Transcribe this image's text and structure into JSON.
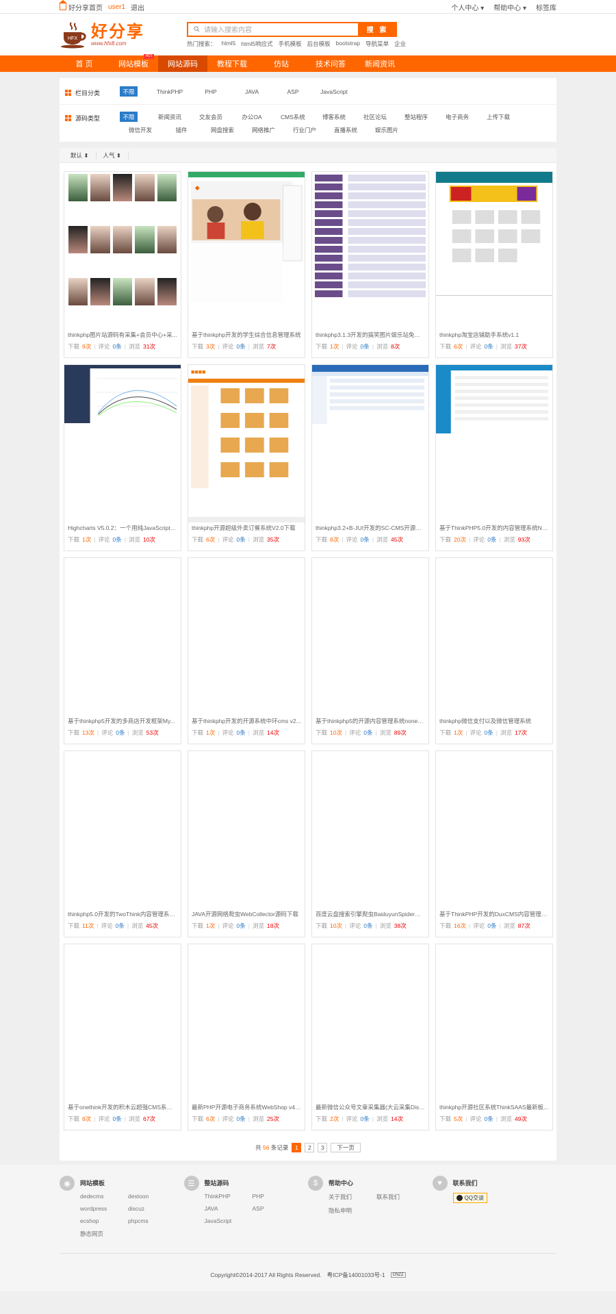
{
  "topbar": {
    "home_link": "好分享首页",
    "user": "user1",
    "logout": "退出",
    "right": [
      "个人中心",
      "帮助中心",
      "标签库"
    ]
  },
  "logo": {
    "title": "好分享",
    "url": "www.hfx8.com"
  },
  "search": {
    "placeholder": "请输入搜索内容",
    "button": "搜 索",
    "hot_label": "热门搜索：",
    "hot": [
      "html5",
      "html5响应式",
      "手机模板",
      "后台模板",
      "bootstrap",
      "导航菜单",
      "企业"
    ]
  },
  "nav": {
    "items": [
      "首 页",
      "网站模板",
      "网站源码",
      "教程下载",
      "仿站",
      "技术问答",
      "新闻资讯"
    ],
    "active": 2,
    "hot_badge": "HOT"
  },
  "filter": {
    "category_label": "栏目分类",
    "categories": [
      "不限",
      "ThinkPHP",
      "PHP",
      "JAVA",
      "ASP",
      "JavaScript"
    ],
    "type_label": "源码类型",
    "types": [
      "不限",
      "新闻资讯",
      "交友会员",
      "办公OA",
      "CMS系统",
      "博客系统",
      "社区论坛",
      "整站程序",
      "电子商务",
      "上传下载",
      "微信开发",
      "插件",
      "网盘搜索",
      "网络推广",
      "行业门户",
      "直播系统",
      "娱乐图片"
    ]
  },
  "sort": [
    "默认",
    "人气"
  ],
  "stats_labels": {
    "down": "下载",
    "comment": "评论",
    "view": "浏览",
    "unit": "次",
    "unit_c": "条"
  },
  "cards": [
    {
      "title": "thinkphp图片站源码有采集+会员中心+采...",
      "down": "9",
      "comment": "0",
      "view": "31",
      "thumb": "photos"
    },
    {
      "title": "基于thinkphp开发的学生综合信息管理系统",
      "down": "3",
      "comment": "0",
      "view": "7",
      "thumb": "mgmt"
    },
    {
      "title": "thinkphp3.1.3开发的搞笑图片娱乐站免费...",
      "down": "1",
      "comment": "0",
      "view": "8",
      "thumb": "list"
    },
    {
      "title": "thinkphp淘宝店铺助手系统v1.1",
      "down": "6",
      "comment": "0",
      "view": "37",
      "thumb": "shop"
    },
    {
      "title": "Highcharts V5.0.2：一个用纯JavaScript编...",
      "down": "1",
      "comment": "0",
      "view": "10",
      "thumb": "chart"
    },
    {
      "title": "thinkphp开源超级外卖订餐系统V2.0下载",
      "down": "6",
      "comment": "0",
      "view": "35",
      "thumb": "food"
    },
    {
      "title": "thinkphp3.2+B-JUI开发的SC-CMS开源内...",
      "down": "8",
      "comment": "0",
      "view": "45",
      "thumb": "admin"
    },
    {
      "title": "基于ThinkPHP5.0开发的内容管理系统New...",
      "down": "20",
      "comment": "0",
      "view": "93",
      "thumb": "admin2"
    },
    {
      "title": "基于thinkphp5开发的多商店开发框架My...",
      "down": "13",
      "comment": "0",
      "view": "53",
      "thumb": ""
    },
    {
      "title": "基于thinkphp开发的开源系统中环cms v2...",
      "down": "1",
      "comment": "0",
      "view": "14",
      "thumb": ""
    },
    {
      "title": "基于thinkphp5的开源内容管理系统noneC...",
      "down": "10",
      "comment": "0",
      "view": "89",
      "thumb": ""
    },
    {
      "title": "thinkphp微信支付以及微信管理系统",
      "down": "1",
      "comment": "0",
      "view": "17",
      "thumb": ""
    },
    {
      "title": "thinkphp5.0开发的TwoThink内容管理系统...",
      "down": "11",
      "comment": "0",
      "view": "45",
      "thumb": ""
    },
    {
      "title": "JAVA开源网络爬虫WebCollector源码下载",
      "down": "1",
      "comment": "0",
      "view": "18",
      "thumb": ""
    },
    {
      "title": "百度云盘搜索引擎爬虫BaiduyunSpider基...",
      "down": "10",
      "comment": "0",
      "view": "38",
      "thumb": ""
    },
    {
      "title": "基于ThinkPHP开发的DuxCMS内容管理系...",
      "down": "16",
      "comment": "0",
      "view": "87",
      "thumb": ""
    },
    {
      "title": "基于onethink开发的积木云超强CMS系统V...",
      "down": "8",
      "comment": "0",
      "view": "67",
      "thumb": ""
    },
    {
      "title": "最新PHP开源电子商务系统WebShop v4.7...",
      "down": "6",
      "comment": "0",
      "view": "25",
      "thumb": ""
    },
    {
      "title": "最新微信公众号文章采集器(大云采集Disc...",
      "down": "2",
      "comment": "0",
      "view": "14",
      "thumb": ""
    },
    {
      "title": "thinkphp开源社区系统ThinkSAAS最新板...",
      "down": "5",
      "comment": "0",
      "view": "49",
      "thumb": ""
    }
  ],
  "pager": {
    "total_prefix": "共",
    "total": "56",
    "total_suffix": "条记录",
    "pages": [
      "1",
      "2",
      "3"
    ],
    "current": "1",
    "next": "下一页"
  },
  "footer": {
    "cols": [
      {
        "icon": "compass-icon",
        "title": "网站模板",
        "links": [
          "dedecms",
          "destoon",
          "wordpress",
          "discuz",
          "ecshop",
          "phpcms",
          "静态网页"
        ]
      },
      {
        "icon": "list-icon",
        "title": "整站源码",
        "links": [
          "ThinkPHP",
          "PHP",
          "JAVA",
          "ASP",
          "JavaScript"
        ]
      },
      {
        "icon": "dollar-icon",
        "title": "帮助中心",
        "links": [
          "关于我们",
          "联系我们",
          "隐私申明"
        ]
      },
      {
        "icon": "heart-icon",
        "title": "联系我们",
        "links": []
      }
    ],
    "qq": "QQ交谈",
    "copyright": "Copyright©2014-2017 All Rights Reserved.",
    "icp": "粤ICP备14001033号-1",
    "cnzz": "CNZZ"
  },
  "colors": {
    "brand": "#ff6600",
    "link_blue": "#2c7cc8",
    "view_red": "#ee0000"
  }
}
